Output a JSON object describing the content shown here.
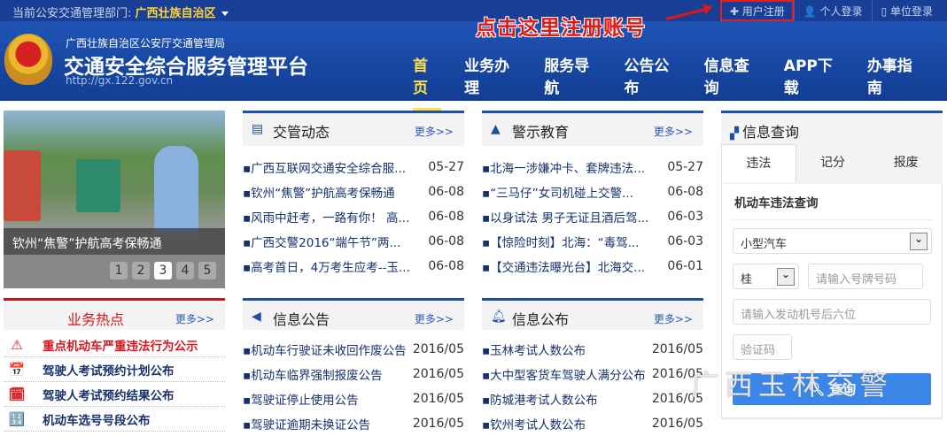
{
  "topbar": {
    "dept_label": "当前公安交通管理部门:",
    "dept_value": "广西壮族自治区",
    "links": [
      "用户注册",
      "个人登录",
      "单位登录"
    ]
  },
  "annotation": "点击这里注册账号",
  "header": {
    "org": "广西壮族自治区公安厅交通管理局",
    "title": "交通安全综合服务管理平台",
    "url": "http://gx.122.gov.cn"
  },
  "nav": [
    "首页",
    "业务办理",
    "服务导航",
    "公告公布",
    "信息查询",
    "APP下载",
    "办事指南"
  ],
  "slider": {
    "caption": "钦州“焦警”护航高考保畅通",
    "pages": [
      "1",
      "2",
      "3",
      "4",
      "5"
    ],
    "active": 3
  },
  "news": {
    "title": "交管动态",
    "more": "更多>>",
    "items": [
      {
        "t": "▪广西互联网交通安全综合服...",
        "d": "05-27"
      },
      {
        "t": "▪钦州“焦警”护航高考保畅通",
        "d": "06-08"
      },
      {
        "t": "▪风雨中赶考，一路有你！ 高...",
        "d": "06-08"
      },
      {
        "t": "▪广西交警2016“端午节”两...",
        "d": "06-08"
      },
      {
        "t": "▪高考首日，4万考生应考--玉...",
        "d": "06-08"
      }
    ]
  },
  "warning": {
    "title": "警示教育",
    "more": "更多>>",
    "items": [
      {
        "t": "▪北海一涉嫌冲卡、套牌违法...",
        "d": "05-27"
      },
      {
        "t": "▪“三马仔”女司机碰上交警...",
        "d": "06-08"
      },
      {
        "t": "▪以身试法 男子无证且酒后驾...",
        "d": "06-03"
      },
      {
        "t": "▪【惊险时刻】北海：“毒驾...",
        "d": "06-03"
      },
      {
        "t": "▪【交通违法曝光台】北海交...",
        "d": "06-01"
      }
    ]
  },
  "hot": {
    "title": "业务热点",
    "more": "更多>>",
    "items": [
      "重点机动车严重违法行为公示",
      "驾驶人考试预约计划公布",
      "驾驶人考试预约结果公布",
      "机动车选号号段公布"
    ]
  },
  "notice": {
    "title": "信息公告",
    "more": "更多>>",
    "items": [
      {
        "t": "▪机动车行驶证未收回作废公告",
        "d": "2016/05"
      },
      {
        "t": "▪机动车临界强制报废公告",
        "d": "2016/05"
      },
      {
        "t": "▪驾驶证停止使用公告",
        "d": "2016/05"
      },
      {
        "t": "▪驾驶证逾期未换证公告",
        "d": "2016/05"
      }
    ]
  },
  "publish": {
    "title": "信息公布",
    "more": "更多>>",
    "items": [
      {
        "t": "▪玉林考试人数公布",
        "d": "2016/05"
      },
      {
        "t": "▪大中型客货车驾驶人满分公布",
        "d": "2016/05"
      },
      {
        "t": "▪防城港考试人数公布",
        "d": "2016/05"
      },
      {
        "t": "▪钦州考试人数公布",
        "d": "2016/05"
      }
    ]
  },
  "query": {
    "title": "信息查询",
    "tabs": [
      "违法",
      "记分",
      "报废"
    ],
    "form_title": "机动车违法查询",
    "vehicle_type": "小型汽车",
    "province": "桂",
    "plate_placeholder": "请输入号牌号码",
    "engine_placeholder": "请输入发动机号后六位",
    "captcha_placeholder": "验证码",
    "submit": "查询"
  },
  "watermark": "广西玉林交警"
}
